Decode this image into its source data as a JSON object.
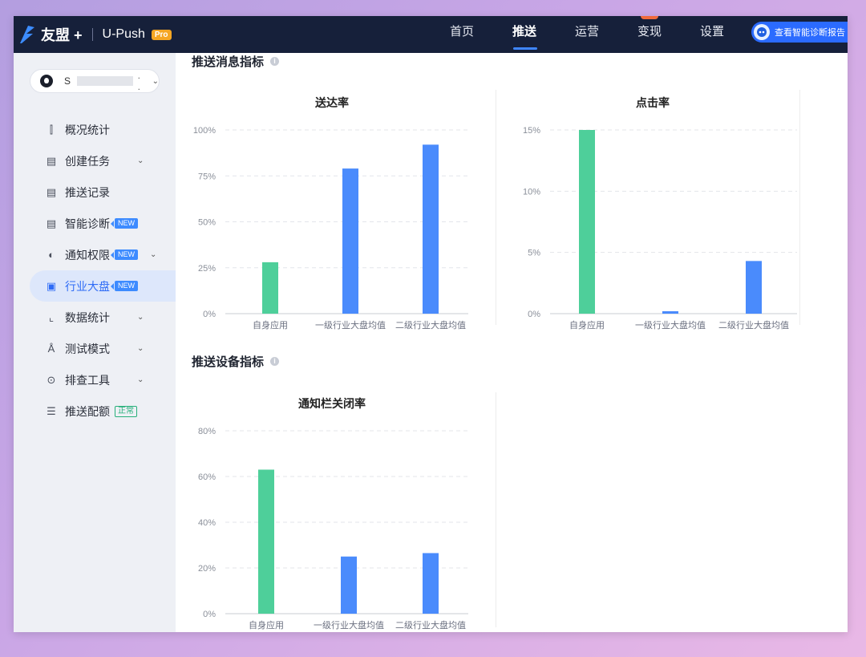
{
  "topbar": {
    "brand_name": "友盟 +",
    "product": "U-Push",
    "pro_badge": "Pro",
    "nav": [
      {
        "label": "首页",
        "active": false
      },
      {
        "label": "推送",
        "active": true
      },
      {
        "label": "运营",
        "active": false
      },
      {
        "label": "变现",
        "active": false
      },
      {
        "label": "设置",
        "active": false
      }
    ],
    "diag_button": "查看智能诊断报告"
  },
  "sidebar": {
    "app_selector": {
      "name_prefix": "S",
      "name_suffix": ". ."
    },
    "items": [
      {
        "label": "概况统计",
        "icon": "chart-icon",
        "glyph": "⌇",
        "chevron": false
      },
      {
        "label": "创建任务",
        "icon": "create-task-icon",
        "glyph": "▤",
        "chevron": true
      },
      {
        "label": "推送记录",
        "icon": "record-icon",
        "glyph": "▤",
        "chevron": false
      },
      {
        "label": "智能诊断",
        "icon": "diagnose-icon",
        "glyph": "▤",
        "chevron": false,
        "badge": "NEW"
      },
      {
        "label": "通知权限",
        "icon": "permission-icon",
        "glyph": "◐",
        "chevron": true,
        "badge": "NEW"
      },
      {
        "label": "行业大盘",
        "icon": "dashboard-icon",
        "glyph": "▣",
        "chevron": false,
        "badge": "NEW",
        "active": true
      },
      {
        "label": "数据统计",
        "icon": "stats-icon",
        "glyph": "⌒",
        "chevron": true
      },
      {
        "label": "测试模式",
        "icon": "flask-icon",
        "glyph": "⚗",
        "chevron": true
      },
      {
        "label": "排查工具",
        "icon": "tool-icon",
        "glyph": "⊙",
        "chevron": true
      },
      {
        "label": "推送配额",
        "icon": "quota-icon",
        "glyph": "☰",
        "chevron": false,
        "ok_badge": "正常"
      }
    ]
  },
  "main": {
    "section1_title": "推送消息指标",
    "section2_title": "推送设备指标"
  },
  "colors": {
    "self": "#4ecf9a",
    "industry": "#4a8bfc"
  },
  "chart_data": [
    {
      "type": "bar",
      "title": "送达率",
      "categories": [
        "自身应用",
        "一级行业大盘均值",
        "二级行业大盘均值"
      ],
      "values": [
        28,
        79,
        92
      ],
      "unit": "%",
      "yticks": [
        0,
        25,
        50,
        75,
        100
      ],
      "ylim": [
        0,
        100
      ],
      "grid": true
    },
    {
      "type": "bar",
      "title": "点击率",
      "categories": [
        "自身应用",
        "一级行业大盘均值",
        "二级行业大盘均值"
      ],
      "values": [
        15,
        0.2,
        4.3
      ],
      "unit": "%",
      "yticks": [
        0,
        5,
        10,
        15
      ],
      "ylim": [
        0,
        15
      ],
      "grid": true
    },
    {
      "type": "bar",
      "title": "通知栏关闭率",
      "categories": [
        "自身应用",
        "一级行业大盘均值",
        "二级行业大盘均值"
      ],
      "values": [
        63,
        25,
        26.5
      ],
      "unit": "%",
      "yticks": [
        0,
        20,
        40,
        60,
        80
      ],
      "ylim": [
        0,
        80
      ],
      "grid": true
    }
  ]
}
